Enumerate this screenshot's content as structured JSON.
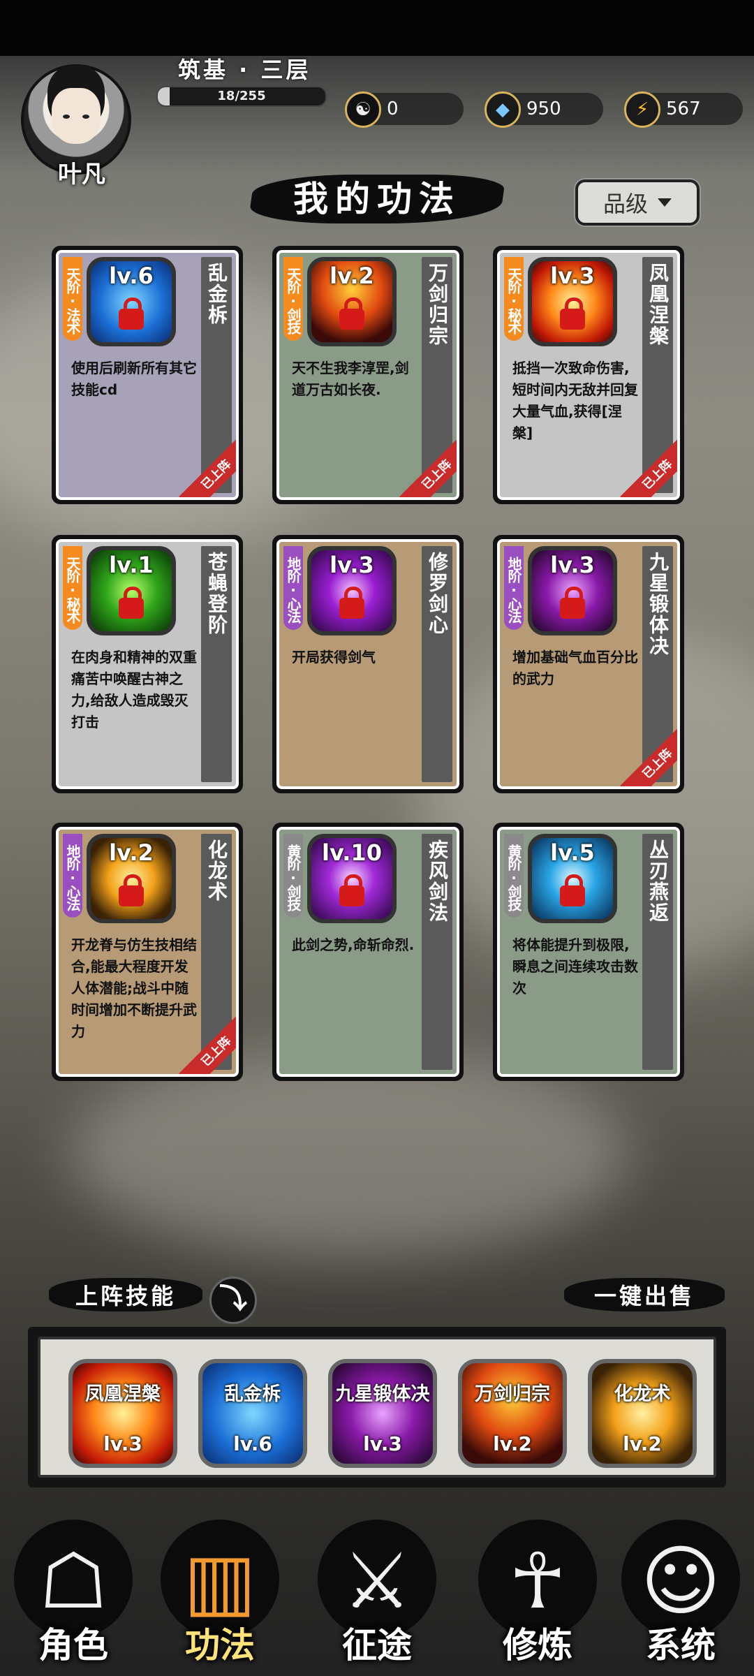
{
  "player": {
    "name": "叶凡",
    "realm": "筑基 · 三层",
    "exp_text": "18/255",
    "exp_progress": 0.07
  },
  "resources": [
    {
      "icon": "yin-yang-icon",
      "value": "0"
    },
    {
      "icon": "spirit-stone-icon",
      "value": "950"
    },
    {
      "icon": "lightning-icon",
      "value": "567"
    }
  ],
  "page": {
    "title": "我的功法",
    "sort_label": "品级"
  },
  "skills": [
    {
      "tag": "天阶·法术",
      "tag_color": "#f58a1f",
      "level": "lv.6",
      "name": "乱金柝",
      "desc": "使用后刷新所有其它技能cd",
      "bg": "#a7a2b8",
      "icon_bg": "radial-gradient(circle,#7fd7ff,#1b6fd6 55%,#0a2b6e)",
      "equipped": "已上阵"
    },
    {
      "tag": "天阶·剑技",
      "tag_color": "#f58a1f",
      "level": "lv.2",
      "name": "万剑归宗",
      "desc": "天不生我李淳罡,剑道万古如长夜.",
      "bg": "#8a9b88",
      "icon_bg": "radial-gradient(circle at 50% 35%,#ffcf3a,#e04a10 45%,#3a0a08 80%)",
      "equipped": "已上阵"
    },
    {
      "tag": "天阶·秘术",
      "tag_color": "#f58a1f",
      "level": "lv.3",
      "name": "凤凰涅槃",
      "desc": "抵挡一次致命伤害,短时间内无敌并回复大量气血,获得[涅槃]",
      "bg": "#c5c5c5",
      "icon_bg": "radial-gradient(circle,#fff29a,#ff8a1a 40%,#c21a06 75%,#3a0505)",
      "equipped": "已上阵"
    },
    {
      "tag": "天阶·秘术",
      "tag_color": "#f58a1f",
      "level": "lv.1",
      "name": "苍蝇登阶",
      "desc": "在肉身和精神的双重痛苦中唤醒古神之力,给敌人造成毁灭打击",
      "bg": "#c5c5c5",
      "icon_bg": "radial-gradient(circle,#b8ff6a,#2fa51a 45%,#083006)",
      "equipped": ""
    },
    {
      "tag": "地阶·心法",
      "tag_color": "#9a4fc0",
      "level": "lv.3",
      "name": "修罗剑心",
      "desc": "开局获得剑气",
      "bg": "#b79b76",
      "icon_bg": "radial-gradient(circle,#f3c2ff,#9a1fd1 40%,#2a0640)",
      "equipped": ""
    },
    {
      "tag": "地阶·心法",
      "tag_color": "#9a4fc0",
      "level": "lv.3",
      "name": "九星锻体决",
      "desc": "增加基础气血百分比的武力",
      "bg": "#b79b76",
      "icon_bg": "radial-gradient(circle,#e9a3ff,#8a1aa8 45%,#1a0522)",
      "equipped": "已上阵"
    },
    {
      "tag": "地阶·心法",
      "tag_color": "#9a4fc0",
      "level": "lv.2",
      "name": "化龙术",
      "desc": "开龙脊与仿生技相结合,能最大程度开发人体潜能;战斗中随时间增加不断提升武力",
      "bg": "#b79b76",
      "icon_bg": "radial-gradient(circle,#fff1a0,#f2a11a 40%,#3a2206 80%)",
      "equipped": "已上阵"
    },
    {
      "tag": "黄阶·剑技",
      "tag_color": "#8a8a8a",
      "level": "lv.10",
      "name": "疾风剑法",
      "desc": "此剑之势,命斩命烈.",
      "bg": "#8a9b88",
      "icon_bg": "radial-gradient(circle,#f7d6ff,#a02ad8 40%,#2a0640)",
      "equipped": ""
    },
    {
      "tag": "黄阶·剑技",
      "tag_color": "#8a8a8a",
      "level": "lv.5",
      "name": "丛刃燕返",
      "desc": "将体能提升到极限,瞬息之间连续攻击数次",
      "bg": "#8a9b88",
      "icon_bg": "radial-gradient(circle,#dff8ff,#2aa6e6 40%,#062a52)",
      "equipped": ""
    }
  ],
  "equipped_section": {
    "label": "上阵技能",
    "toggle_icon": "arrow-down-icon",
    "sell_label": "一键出售",
    "slots": [
      {
        "name": "凤凰涅槃",
        "level": "lv.3",
        "bg": "radial-gradient(circle,#fff29a,#ff8a1a 40%,#c21a06 75%,#3a0505)"
      },
      {
        "name": "乱金柝",
        "level": "lv.6",
        "bg": "radial-gradient(circle,#7fd7ff,#1b6fd6 55%,#0a2b6e)"
      },
      {
        "name": "九星锻体决",
        "level": "lv.3",
        "bg": "radial-gradient(circle,#e9a3ff,#8a1aa8 45%,#1a0522)"
      },
      {
        "name": "万剑归宗",
        "level": "lv.2",
        "bg": "radial-gradient(circle at 50% 35%,#ffcf3a,#e04a10 45%,#3a0a08 80%)"
      },
      {
        "name": "化龙术",
        "level": "lv.2",
        "bg": "radial-gradient(circle,#fff1a0,#f2a11a 40%,#3a2206 80%)"
      }
    ]
  },
  "nav": [
    {
      "label": "角色",
      "icon": "character-icon",
      "active": false
    },
    {
      "label": "功法",
      "icon": "book-icon",
      "active": true
    },
    {
      "label": "征途",
      "icon": "sword-icon",
      "active": false
    },
    {
      "label": "修炼",
      "icon": "meditation-icon",
      "active": false
    },
    {
      "label": "系统",
      "icon": "system-icon",
      "active": false
    }
  ]
}
